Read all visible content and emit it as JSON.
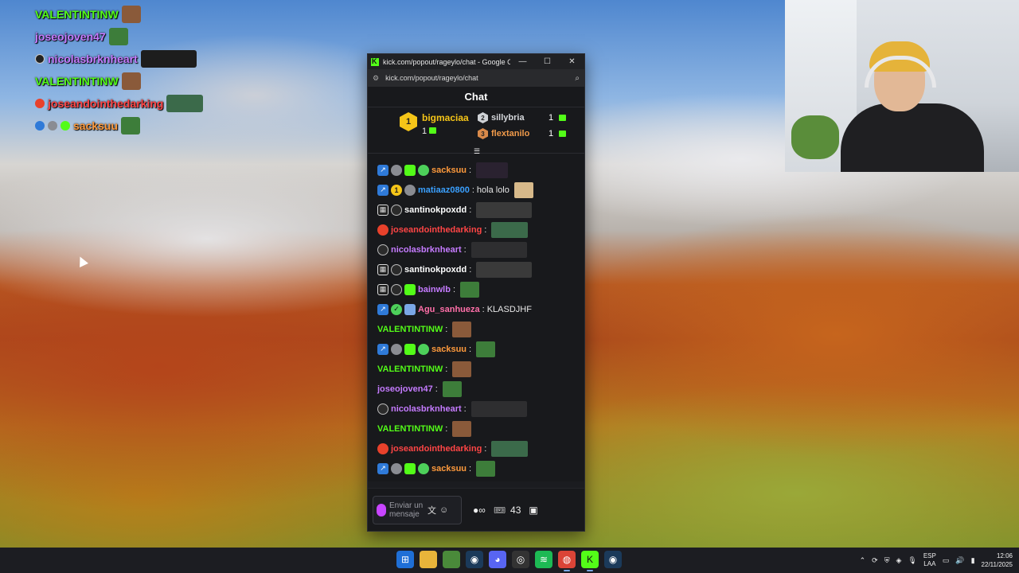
{
  "browser": {
    "title": "kick.com/popout/rageylo/chat - Google Chro...",
    "url": "kick.com/popout/rageylo/chat"
  },
  "chat": {
    "header": "Chat",
    "leaderboard": {
      "first": {
        "rank": "1",
        "name": "bigmaciaa",
        "count": "1"
      },
      "second": {
        "rank": "2",
        "name": "sillybria",
        "count": "1"
      },
      "third": {
        "rank": "3",
        "name": "flextanilo",
        "count": "1"
      }
    },
    "messages": [
      {
        "user": "sacksuu",
        "color": "#ff9a3c",
        "text": ""
      },
      {
        "user": "matiaaz0800",
        "color": "#3aa0ff",
        "text": "hola lolo"
      },
      {
        "user": "santinokpoxdd",
        "color": "#ffffff",
        "text": ""
      },
      {
        "user": "joseandointhedarking",
        "color": "#ff4545",
        "text": ""
      },
      {
        "user": "nicolasbrknheart",
        "color": "#c57bff",
        "text": ""
      },
      {
        "user": "santinokpoxdd",
        "color": "#ffffff",
        "text": ""
      },
      {
        "user": "bainwlb",
        "color": "#c57bff",
        "text": ""
      },
      {
        "user": "Agu_sanhueza",
        "color": "#ff6fa8",
        "text": "KLASDJHF"
      },
      {
        "user": "VALENTINTINW",
        "color": "#53fc18",
        "text": ""
      },
      {
        "user": "sacksuu",
        "color": "#ff9a3c",
        "text": ""
      },
      {
        "user": "VALENTINTINW",
        "color": "#53fc18",
        "text": ""
      },
      {
        "user": "joseojoven47",
        "color": "#c57bff",
        "text": ""
      },
      {
        "user": "nicolasbrknheart",
        "color": "#c57bff",
        "text": ""
      },
      {
        "user": "VALENTINTINW",
        "color": "#53fc18",
        "text": ""
      },
      {
        "user": "joseandointhedarking",
        "color": "#ff4545",
        "text": ""
      },
      {
        "user": "sacksuu",
        "color": "#ff9a3c",
        "text": ""
      }
    ],
    "composer": {
      "placeholder": "Enviar un mensaje",
      "points": "43"
    }
  },
  "overlay_chat": [
    {
      "user": "VALENTINTINW",
      "color": "#53fc18"
    },
    {
      "user": "joseojoven47",
      "color": "#c57bff"
    },
    {
      "user": "nicolasbrknheart",
      "color": "#c57bff"
    },
    {
      "user": "VALENTINTINW",
      "color": "#53fc18"
    },
    {
      "user": "joseandointhedarking",
      "color": "#ff4545"
    },
    {
      "user": "sacksuu",
      "color": "#ff9a3c"
    }
  ],
  "taskbar": {
    "lang": "ESP",
    "lang_sub": "LAA",
    "time": "12:06",
    "date": "22/11/2025"
  }
}
